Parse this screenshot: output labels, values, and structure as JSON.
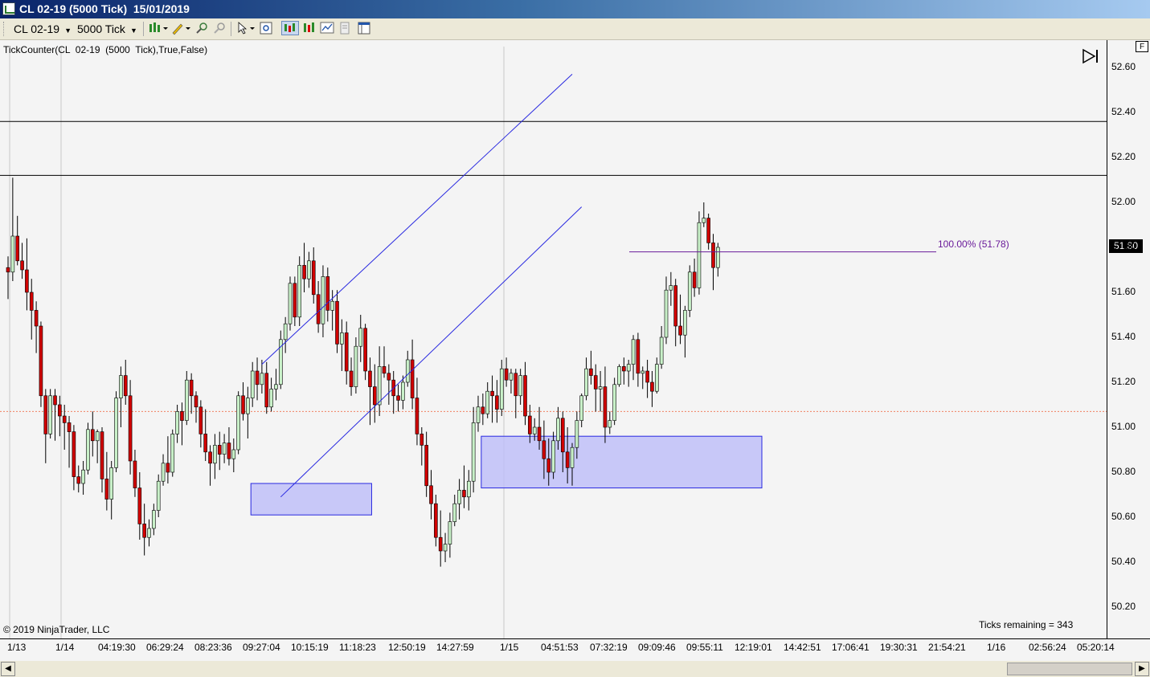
{
  "window": {
    "title": "CL 02-19 (5000 Tick)  15/01/2019"
  },
  "toolbar": {
    "instrument": "CL 02-19",
    "interval": "5000 Tick",
    "icons": [
      "bar-type-icon",
      "draw-pencil-icon",
      "zoom-in-icon",
      "zoom-out-icon",
      "pointer-icon",
      "properties-icon",
      "chart-style-icon",
      "indicators-icon",
      "strategies-icon",
      "data-box-icon",
      "panels-icon"
    ]
  },
  "chart": {
    "indicator_label": "TickCounter(CL  02-19  (5000  Tick),True,False)",
    "copyright": "© 2019 NinjaTrader, LLC",
    "ticks_remaining": "Ticks remaining = 343",
    "fib_label": "100.00% (51.78)",
    "current_price": "51.80",
    "f_button": "F",
    "colors": {
      "up_body": "#c8f0c8",
      "down_body": "#d00000",
      "wick": "#000000",
      "trend_line": "#2828e0",
      "rect_fill": "#c0c0f8",
      "rect_stroke": "#2828e0",
      "fib_line": "#6a1b9a",
      "hline": "#000000",
      "dashed_line": "#f08060"
    }
  },
  "chart_data": {
    "type": "candlestick",
    "instrument": "CL 02-19",
    "bar_interval": "5000 Tick",
    "ylim": [
      50.12,
      52.72
    ],
    "y_ticks": [
      "52.60",
      "52.40",
      "52.20",
      "52.00",
      "51.80",
      "51.60",
      "51.40",
      "51.20",
      "51.00",
      "50.80",
      "50.60",
      "50.40",
      "50.20"
    ],
    "x_ticks": [
      "1/13",
      "1/14",
      "04:19:30",
      "06:29:24",
      "08:23:36",
      "09:27:04",
      "10:15:19",
      "11:18:23",
      "12:50:19",
      "14:27:59",
      "1/15",
      "04:51:53",
      "07:32:19",
      "09:09:46",
      "09:55:11",
      "12:19:01",
      "14:42:51",
      "17:06:41",
      "19:30:31",
      "21:54:21",
      "1/16",
      "02:56:24",
      "05:20:14"
    ],
    "horizontal_lines": [
      52.36,
      52.12
    ],
    "dashed_line": 51.07,
    "fib_level": 51.78,
    "candles": [
      [
        51.71,
        51.76,
        51.57,
        51.69
      ],
      [
        51.69,
        52.11,
        51.65,
        51.85
      ],
      [
        51.85,
        51.94,
        51.72,
        51.74
      ],
      [
        51.74,
        51.82,
        51.66,
        51.7
      ],
      [
        51.7,
        51.84,
        51.52,
        51.6
      ],
      [
        51.6,
        51.66,
        51.39,
        51.52
      ],
      [
        51.52,
        51.56,
        51.33,
        51.45
      ],
      [
        51.45,
        51.47,
        51.09,
        51.14
      ],
      [
        51.14,
        51.17,
        50.84,
        50.97
      ],
      [
        50.97,
        51.17,
        50.95,
        51.14
      ],
      [
        51.14,
        51.17,
        50.94,
        51.1
      ],
      [
        51.1,
        51.14,
        50.96,
        51.05
      ],
      [
        51.05,
        51.1,
        50.9,
        51.02
      ],
      [
        51.02,
        51.05,
        50.82,
        50.98
      ],
      [
        50.98,
        51.01,
        50.72,
        50.78
      ],
      [
        50.78,
        50.83,
        50.71,
        50.75
      ],
      [
        50.75,
        50.85,
        50.7,
        50.81
      ],
      [
        50.81,
        51.02,
        50.79,
        50.99
      ],
      [
        50.99,
        51.07,
        50.87,
        50.94
      ],
      [
        50.94,
        50.99,
        50.84,
        50.98
      ],
      [
        50.98,
        51.0,
        50.71,
        50.77
      ],
      [
        50.77,
        50.89,
        50.63,
        50.68
      ],
      [
        50.68,
        50.85,
        50.59,
        50.82
      ],
      [
        50.82,
        51.16,
        50.8,
        51.13
      ],
      [
        51.13,
        51.27,
        51.0,
        51.23
      ],
      [
        51.23,
        51.3,
        51.1,
        51.14
      ],
      [
        51.14,
        51.21,
        50.79,
        50.85
      ],
      [
        50.85,
        50.9,
        50.69,
        50.73
      ],
      [
        50.73,
        50.8,
        50.5,
        50.57
      ],
      [
        50.57,
        50.66,
        50.43,
        50.51
      ],
      [
        50.51,
        50.59,
        50.47,
        50.55
      ],
      [
        50.55,
        50.66,
        50.52,
        50.63
      ],
      [
        50.63,
        50.79,
        50.6,
        50.76
      ],
      [
        50.76,
        50.88,
        50.74,
        50.84
      ],
      [
        50.84,
        50.96,
        50.75,
        50.8
      ],
      [
        50.8,
        50.99,
        50.78,
        50.97
      ],
      [
        50.97,
        51.1,
        50.93,
        51.07
      ],
      [
        51.07,
        51.11,
        50.92,
        51.03
      ],
      [
        51.03,
        51.25,
        51.01,
        51.21
      ],
      [
        51.21,
        51.24,
        51.06,
        51.14
      ],
      [
        51.14,
        51.16,
        51.02,
        51.09
      ],
      [
        51.09,
        51.12,
        50.91,
        50.97
      ],
      [
        50.97,
        51.08,
        50.85,
        50.89
      ],
      [
        50.89,
        50.92,
        50.74,
        50.84
      ],
      [
        50.84,
        50.97,
        50.77,
        50.92
      ],
      [
        50.92,
        50.98,
        50.81,
        50.88
      ],
      [
        50.88,
        50.97,
        50.84,
        50.93
      ],
      [
        50.93,
        51.0,
        50.83,
        50.86
      ],
      [
        50.86,
        50.95,
        50.8,
        50.9
      ],
      [
        50.9,
        51.16,
        50.88,
        51.14
      ],
      [
        51.14,
        51.2,
        51.03,
        51.06
      ],
      [
        51.06,
        51.18,
        50.95,
        51.13
      ],
      [
        51.13,
        51.29,
        51.09,
        51.25
      ],
      [
        51.25,
        51.31,
        51.12,
        51.19
      ],
      [
        51.19,
        51.3,
        51.15,
        51.24
      ],
      [
        51.24,
        51.29,
        51.06,
        51.09
      ],
      [
        51.09,
        51.22,
        51.07,
        51.17
      ],
      [
        51.17,
        51.26,
        51.12,
        51.19
      ],
      [
        51.19,
        51.43,
        51.17,
        51.39
      ],
      [
        51.39,
        51.49,
        51.33,
        51.46
      ],
      [
        51.46,
        51.67,
        51.43,
        51.64
      ],
      [
        51.64,
        51.67,
        51.45,
        51.49
      ],
      [
        51.49,
        51.76,
        51.45,
        51.72
      ],
      [
        51.72,
        51.82,
        51.6,
        51.66
      ],
      [
        51.66,
        51.78,
        51.62,
        51.74
      ],
      [
        51.74,
        51.8,
        51.55,
        51.59
      ],
      [
        51.59,
        51.65,
        51.42,
        51.46
      ],
      [
        51.46,
        51.72,
        51.4,
        51.67
      ],
      [
        51.67,
        51.71,
        51.47,
        51.52
      ],
      [
        51.52,
        51.61,
        51.43,
        51.56
      ],
      [
        51.56,
        51.61,
        51.33,
        51.37
      ],
      [
        51.37,
        51.48,
        51.25,
        51.42
      ],
      [
        51.42,
        51.47,
        51.19,
        51.25
      ],
      [
        51.25,
        51.31,
        51.14,
        51.18
      ],
      [
        51.18,
        51.4,
        51.15,
        51.36
      ],
      [
        51.36,
        51.5,
        51.29,
        51.44
      ],
      [
        51.44,
        51.46,
        51.21,
        51.25
      ],
      [
        51.25,
        51.31,
        51.01,
        51.18
      ],
      [
        51.18,
        51.28,
        51.02,
        51.1
      ],
      [
        51.1,
        51.36,
        51.05,
        51.27
      ],
      [
        51.27,
        51.36,
        51.22,
        51.24
      ],
      [
        51.24,
        51.28,
        51.1,
        51.21
      ],
      [
        51.21,
        51.25,
        51.06,
        51.14
      ],
      [
        51.14,
        51.19,
        51.07,
        51.12
      ],
      [
        51.12,
        51.23,
        51.08,
        51.2
      ],
      [
        51.2,
        51.34,
        51.18,
        51.3
      ],
      [
        51.3,
        51.39,
        51.08,
        51.13
      ],
      [
        51.13,
        51.22,
        50.92,
        50.97
      ],
      [
        50.97,
        51.0,
        50.83,
        50.92
      ],
      [
        50.92,
        50.98,
        50.69,
        50.74
      ],
      [
        50.74,
        50.81,
        50.59,
        50.66
      ],
      [
        50.66,
        50.7,
        50.47,
        50.51
      ],
      [
        50.51,
        50.63,
        50.38,
        50.45
      ],
      [
        50.45,
        50.53,
        50.4,
        50.48
      ],
      [
        50.48,
        50.62,
        50.42,
        50.58
      ],
      [
        50.58,
        50.7,
        50.56,
        50.66
      ],
      [
        50.66,
        50.77,
        50.59,
        50.72
      ],
      [
        50.72,
        50.83,
        50.64,
        50.69
      ],
      [
        50.69,
        50.81,
        50.63,
        50.76
      ],
      [
        50.76,
        51.09,
        50.71,
        51.02
      ],
      [
        51.02,
        51.14,
        50.98,
        51.09
      ],
      [
        51.09,
        51.15,
        51.01,
        51.06
      ],
      [
        51.06,
        51.2,
        51.04,
        51.16
      ],
      [
        51.16,
        51.23,
        51.02,
        51.14
      ],
      [
        51.14,
        51.21,
        51.02,
        51.08
      ],
      [
        51.08,
        51.3,
        51.05,
        51.26
      ],
      [
        51.26,
        51.31,
        51.18,
        51.21
      ],
      [
        51.21,
        51.26,
        51.15,
        51.24
      ],
      [
        51.24,
        51.26,
        51.04,
        51.14
      ],
      [
        51.14,
        51.26,
        51.1,
        51.23
      ],
      [
        51.23,
        51.29,
        51.01,
        51.05
      ],
      [
        51.05,
        51.1,
        50.93,
        50.97
      ],
      [
        50.97,
        51.04,
        50.94,
        51.0
      ],
      [
        51.0,
        51.09,
        50.9,
        50.94
      ],
      [
        50.94,
        51.03,
        50.77,
        50.86
      ],
      [
        50.86,
        50.95,
        50.74,
        50.8
      ],
      [
        50.8,
        50.98,
        50.77,
        50.94
      ],
      [
        50.94,
        51.09,
        50.9,
        51.04
      ],
      [
        51.04,
        51.07,
        50.8,
        50.89
      ],
      [
        50.89,
        51.0,
        50.75,
        50.82
      ],
      [
        50.82,
        50.93,
        50.74,
        50.91
      ],
      [
        50.91,
        51.07,
        50.86,
        51.03
      ],
      [
        51.03,
        51.15,
        51.0,
        51.14
      ],
      [
        51.14,
        51.31,
        51.12,
        51.26
      ],
      [
        51.26,
        51.34,
        51.19,
        51.23
      ],
      [
        51.23,
        51.28,
        51.07,
        51.17
      ],
      [
        51.17,
        51.25,
        51.07,
        51.18
      ],
      [
        51.18,
        51.27,
        50.93,
        51.0
      ],
      [
        51.0,
        51.07,
        50.97,
        51.03
      ],
      [
        51.03,
        51.22,
        51.01,
        51.19
      ],
      [
        51.19,
        51.28,
        51.18,
        51.27
      ],
      [
        51.27,
        51.31,
        51.19,
        51.25
      ],
      [
        51.25,
        51.3,
        51.18,
        51.28
      ],
      [
        51.28,
        51.41,
        51.21,
        51.39
      ],
      [
        51.39,
        51.42,
        51.18,
        51.24
      ],
      [
        51.24,
        51.27,
        51.17,
        51.25
      ],
      [
        51.25,
        51.3,
        51.13,
        51.2
      ],
      [
        51.2,
        51.25,
        51.09,
        51.16
      ],
      [
        51.16,
        51.31,
        51.15,
        51.28
      ],
      [
        51.28,
        51.45,
        51.26,
        51.4
      ],
      [
        51.4,
        51.67,
        51.37,
        51.61
      ],
      [
        51.61,
        51.69,
        51.54,
        51.63
      ],
      [
        51.63,
        51.66,
        51.36,
        51.45
      ],
      [
        51.45,
        51.59,
        51.37,
        51.41
      ],
      [
        51.41,
        51.54,
        51.31,
        51.52
      ],
      [
        51.52,
        51.72,
        51.49,
        51.69
      ],
      [
        51.69,
        51.75,
        51.58,
        51.62
      ],
      [
        51.62,
        51.96,
        51.59,
        51.91
      ],
      [
        51.91,
        52.0,
        51.89,
        51.93
      ],
      [
        51.93,
        51.95,
        51.79,
        51.82
      ],
      [
        51.82,
        51.86,
        51.61,
        51.71
      ],
      [
        51.71,
        51.82,
        51.67,
        51.8
      ]
    ],
    "drawings": {
      "trend_lines": [
        {
          "from": [
            54,
            51.28
          ],
          "to": [
            120,
            52.57
          ]
        },
        {
          "from": [
            58,
            50.69
          ],
          "to": [
            122,
            51.98
          ]
        }
      ],
      "rectangles": [
        {
          "x0_bar": 52,
          "x1_bar": 77,
          "y_top": 50.75,
          "y_bottom": 50.61
        },
        {
          "x0_bar": 101,
          "x1_bar": 160,
          "y_top": 50.96,
          "y_bottom": 50.73
        }
      ]
    }
  }
}
